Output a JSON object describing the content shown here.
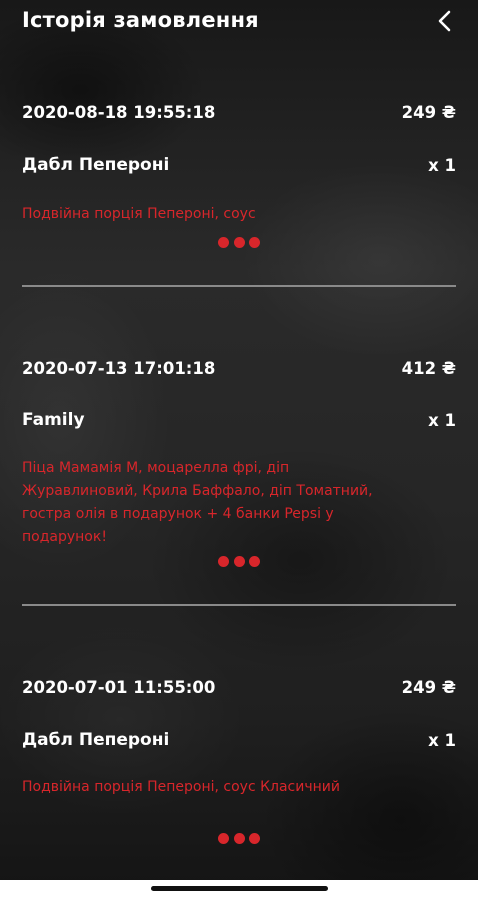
{
  "header": {
    "title": "Історія замовлення",
    "back_icon": "chevron-left-icon"
  },
  "orders": [
    {
      "datetime": "2020-08-18 19:55:18",
      "price": "249 ₴",
      "item": "Дабл Пепероні",
      "qty": "x 1",
      "description": "Подвійна порція Пепероні, соус"
    },
    {
      "datetime": "2020-07-13 17:01:18",
      "price": "412 ₴",
      "item": "Family",
      "qty": "x 1",
      "description": "Піца Мамамія М, моцарелла фрі, діп Журавлиновий, Крила Баффало, діп Томатний, гостра олія в подарунок + 4 банки Pepsi у подарунок!"
    },
    {
      "datetime": "2020-07-01 11:55:00",
      "price": "249 ₴",
      "item": "Дабл Пепероні",
      "qty": "x 1",
      "description": "Подвійна порція Пепероні, соус Класичний"
    }
  ],
  "colors": {
    "accent": "#d8262b",
    "text": "#ffffff",
    "divider": "#8a8a8a"
  }
}
